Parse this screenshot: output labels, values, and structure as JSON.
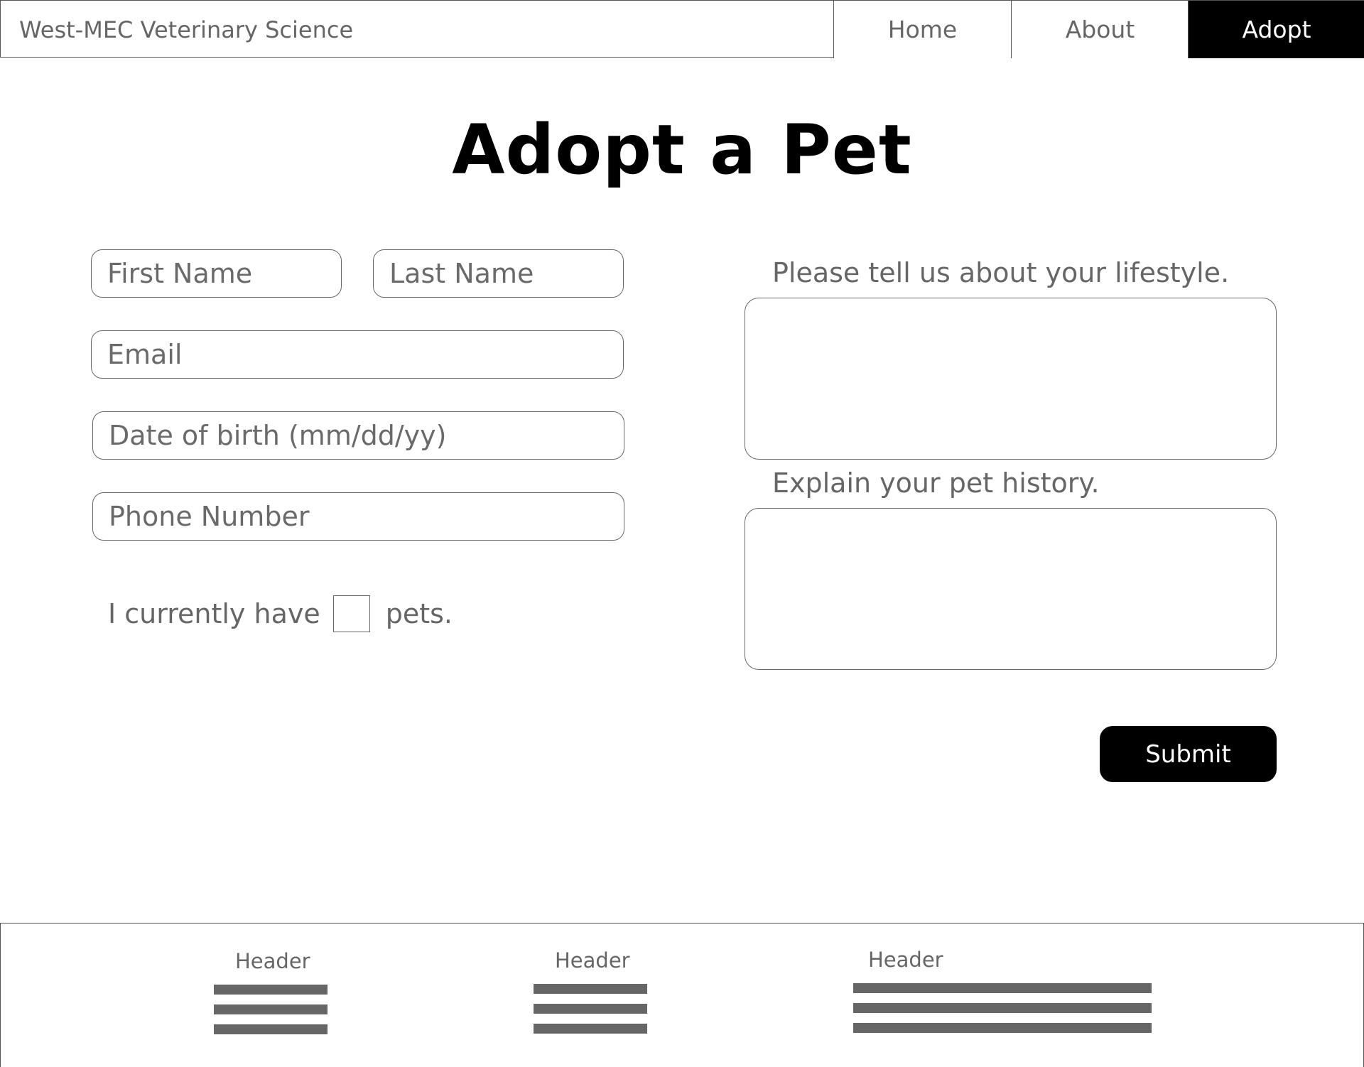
{
  "nav": {
    "brand": "West-MEC Veterinary Science",
    "tabs": [
      {
        "label": "Home"
      },
      {
        "label": "About"
      },
      {
        "label": "Adopt"
      }
    ]
  },
  "main": {
    "title": "Adopt a Pet",
    "form": {
      "first_name_placeholder": "First Name",
      "last_name_placeholder": "Last Name",
      "email_placeholder": "Email",
      "dob_placeholder": "Date of birth (mm/dd/yy)",
      "phone_placeholder": "Phone Number",
      "pets_prefix": "I currently have",
      "pets_suffix": "pets.",
      "lifestyle_label": "Please tell us about your lifestyle.",
      "history_label": "Explain your pet history.",
      "submit_label": "Submit"
    }
  },
  "footer": {
    "columns": [
      {
        "header": "Header"
      },
      {
        "header": "Header"
      },
      {
        "header": "Header"
      }
    ]
  },
  "colors": {
    "active_tab_bg": "#000000",
    "text_gray": "#666666",
    "submit_bg": "#000000"
  }
}
